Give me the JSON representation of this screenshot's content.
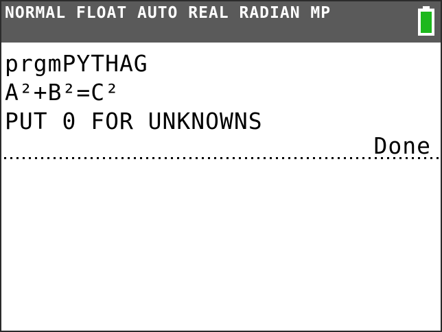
{
  "status_bar": {
    "mode_text": "NORMAL FLOAT AUTO REAL RADIAN MP",
    "battery_icon": "battery-full-icon",
    "battery_level": 1.0,
    "battery_color": "#1db81d",
    "background_color": "#5a5a5a"
  },
  "home_screen": {
    "lines": [
      "prgmPYTHAG",
      "A²+B²=C²",
      "PUT 0 FOR UNKNOWNS"
    ],
    "result": "Done"
  }
}
